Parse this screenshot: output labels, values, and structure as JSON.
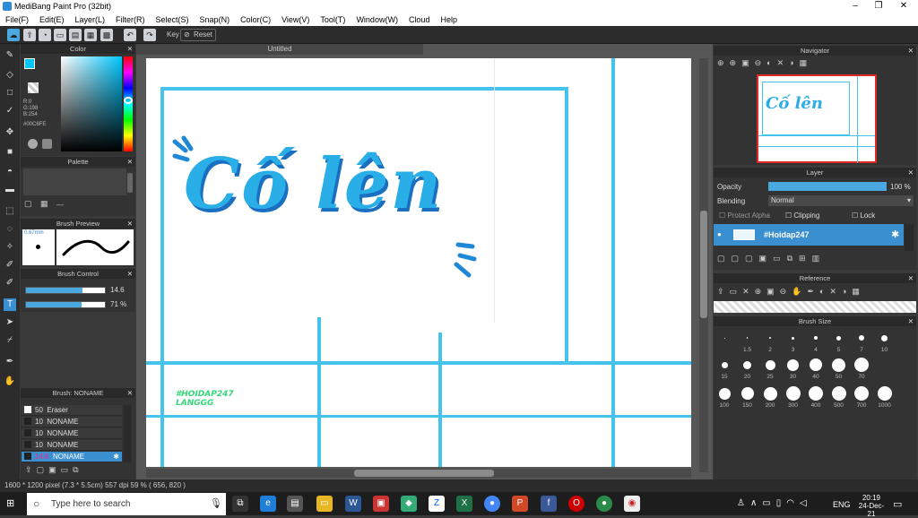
{
  "window": {
    "title": "MediBang Paint Pro (32bit)",
    "min": "–",
    "max": "❐",
    "close": "✕"
  },
  "menu": [
    "File(F)",
    "Edit(E)",
    "Layer(L)",
    "Filter(R)",
    "Select(S)",
    "Snap(N)",
    "Color(C)",
    "View(V)",
    "Tool(T)",
    "Window(W)",
    "Cloud",
    "Help"
  ],
  "toolbar": {
    "key_label": "Key",
    "reset_label": "Reset"
  },
  "panels": {
    "color": "Color",
    "palette": "Palette",
    "brush_preview": "Brush Preview",
    "brush_control": "Brush Control",
    "brush_list": "Brush: NONAME",
    "navigator": "Navigator",
    "layer": "Layer",
    "reference": "Reference",
    "brush_size": "Brush Size"
  },
  "color": {
    "r": "R:0",
    "g": "G:198",
    "b": "B:254",
    "hex": "#00C6FE",
    "swatch": "#00c6fe"
  },
  "brush_preview": {
    "size": "0.67mm"
  },
  "brush_control": {
    "size_value": "14.6",
    "size_fill": 0.72,
    "opacity_value": "71 %",
    "opacity_fill": 0.71
  },
  "brush_list": [
    {
      "size": "50",
      "name": "Eraser"
    },
    {
      "size": "10",
      "name": "NONAME"
    },
    {
      "size": "10",
      "name": "NONAME"
    },
    {
      "size": "10",
      "name": "NONAME"
    },
    {
      "size": "14.6",
      "name": "NONAME",
      "selected": true
    }
  ],
  "document": {
    "tab": "Untitled",
    "headline": "Cố lên",
    "watermark1": "#HOIDAP247",
    "watermark2": "LANGGG"
  },
  "layer": {
    "opacity_label": "Opacity",
    "opacity_value": "100 %",
    "blending_label": "Blending",
    "blending_value": "Normal",
    "protect_alpha": "Protect Alpha",
    "clipping": "Clipping",
    "lock": "Lock",
    "layer_name": "#Hoidap247"
  },
  "brush_sizes_row1": [
    "",
    "1.5",
    "2",
    "3",
    "4",
    "5",
    "7",
    "10"
  ],
  "brush_sizes_row2": [
    "15",
    "20",
    "25",
    "30",
    "40",
    "50",
    "70"
  ],
  "brush_sizes_row3": [
    "100",
    "150",
    "200",
    "300",
    "400",
    "500",
    "700",
    "1000"
  ],
  "status": {
    "text": "1600 * 1200 pixel    (7.3 * 5.5cm)    557 dpi    59 %    ( 656, 820 )"
  },
  "taskbar": {
    "search_placeholder": "Type here to search",
    "lang": "ENG",
    "time": "20:19",
    "date": "24-Dec-21"
  }
}
